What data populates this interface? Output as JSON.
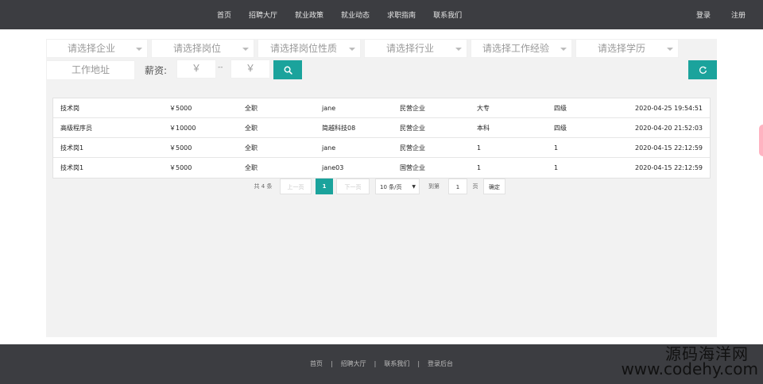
{
  "nav": {
    "items": [
      "首页",
      "招聘大厅",
      "就业政策",
      "就业动态",
      "求职指南",
      "联系我们"
    ],
    "login": "登录",
    "register": "注册"
  },
  "filters": {
    "company": "请选择企业",
    "position": "请选择岗位",
    "position_type": "请选择岗位性质",
    "industry": "请选择行业",
    "experience": "请选择工作经验",
    "education": "请选择学历",
    "address_placeholder": "工作地址",
    "salary_label": "薪资:",
    "salary_min_placeholder": "￥",
    "salary_sep": "--",
    "salary_max_placeholder": "￥"
  },
  "table": {
    "rows": [
      [
        "技术岗",
        "￥5000",
        "全职",
        "jane",
        "民营企业",
        "大专",
        "四级",
        "2020-04-25 19:54:51"
      ],
      [
        "高级程序员",
        "￥10000",
        "全职",
        "简越科技08",
        "民营企业",
        "本科",
        "四级",
        "2020-04-20 21:52:03"
      ],
      [
        "技术岗1",
        "￥5000",
        "全职",
        "jane",
        "民营企业",
        "1",
        "1",
        "2020-04-15 22:12:59"
      ],
      [
        "技术岗1",
        "￥5000",
        "全职",
        "jane03",
        "国营企业",
        "1",
        "1",
        "2020-04-15 22:12:59"
      ]
    ]
  },
  "pager": {
    "total": "共 4 条",
    "prev": "上一页",
    "current": "1",
    "next": "下一页",
    "page_size": "10 条/页",
    "goto": "到第",
    "goto_value": "1",
    "page_unit": "页",
    "confirm": "确定"
  },
  "footer": {
    "links": [
      "首页",
      "招聘大厅",
      "联系我们",
      "登录后台"
    ],
    "sep": "|"
  },
  "watermark": {
    "line1": "源码海洋网",
    "line2": "www.codehy.com"
  },
  "colors": {
    "accent": "#1ba39c",
    "topbar": "#3c3d41"
  },
  "icons": {
    "search": "search-icon",
    "refresh": "refresh-icon"
  }
}
